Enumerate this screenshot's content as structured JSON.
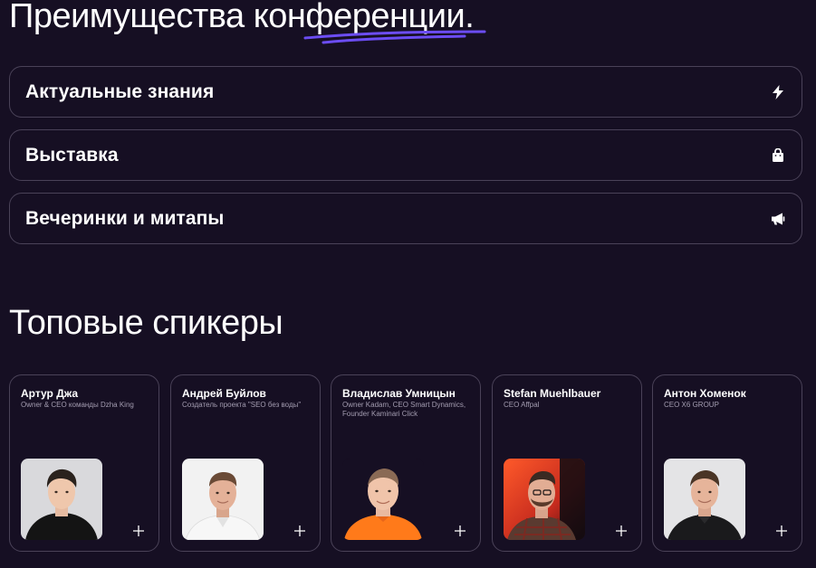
{
  "hero": {
    "title_prefix": "Преимущества ",
    "title_highlight": "конференции",
    "title_suffix": "."
  },
  "colors": {
    "background": "#160f23",
    "border": "#4a4258",
    "accent_underline": "#6c4df4",
    "muted_text": "#a39cb0"
  },
  "features": [
    {
      "label": "Актуальные знания",
      "icon": "lightning-icon"
    },
    {
      "label": "Выставка",
      "icon": "shopping-bag-icon"
    },
    {
      "label": "Вечеринки и митапы",
      "icon": "megaphone-icon"
    }
  ],
  "speakers_section": {
    "title": "Топовые спикеры"
  },
  "speakers": [
    {
      "name": "Артур Джа",
      "role": "Owner & CEO команды Dzha King"
    },
    {
      "name": "Андрей Буйлов",
      "role": "Создатель проекта \"SEO без воды\""
    },
    {
      "name": "Владислав Умницын",
      "role": "Owner Kadam, CEO Smart Dynamics, Founder Kaminari Click"
    },
    {
      "name": "Stefan Muehlbauer",
      "role": "CEO Affpal"
    },
    {
      "name": "Антон Хоменок",
      "role": "CEO X6 GROUP"
    }
  ]
}
